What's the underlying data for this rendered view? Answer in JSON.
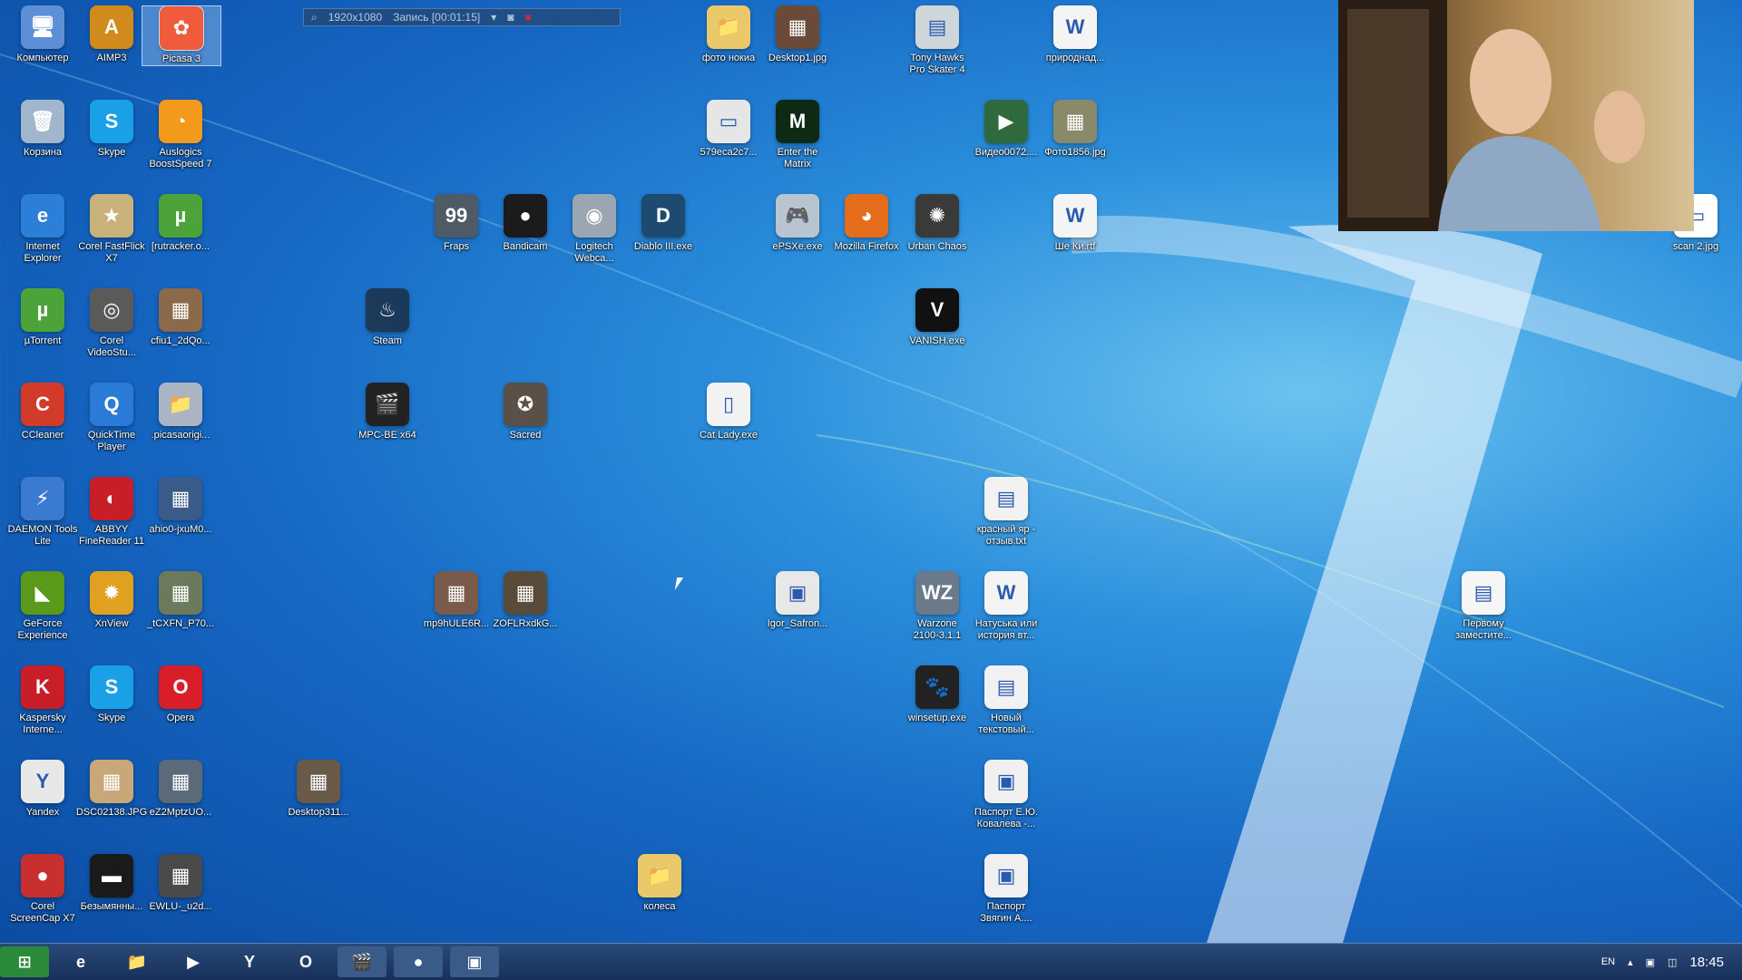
{
  "recorder": {
    "resolution": "1920x1080",
    "status": "Запись [00:01:15]"
  },
  "icons": [
    {
      "label": "Компьютер",
      "name": "computer-icon",
      "color": "#5d8fd6",
      "glyph": "🖥"
    },
    {
      "label": "AIMP3",
      "name": "aimp-icon",
      "color": "#d18a1c",
      "glyph": "A"
    },
    {
      "label": "Picasa 3",
      "name": "picasa-icon",
      "color": "#ef5b3b",
      "glyph": "✿",
      "selected": true
    },
    {
      "label": "Корзина",
      "name": "recycle-bin-icon",
      "color": "#9fb6cc",
      "glyph": "🗑"
    },
    {
      "label": "Skype",
      "name": "skype-icon",
      "color": "#1aa0e6",
      "glyph": "S"
    },
    {
      "label": "Auslogics\nBoostSpeed 7",
      "name": "auslogics-icon",
      "color": "#f39a1d",
      "glyph": "◔"
    },
    {
      "label": "Internet\nExplorer",
      "name": "internet-explorer-icon",
      "color": "#2b7fd8",
      "glyph": "e"
    },
    {
      "label": "Corel FastFlick\nX7",
      "name": "corel-fastflick-icon",
      "color": "#c9b27a",
      "glyph": "★"
    },
    {
      "label": "[rutracker.o...",
      "name": "utorrent-link-icon",
      "color": "#4ba33a",
      "glyph": "µ"
    },
    {
      "label": "Fraps",
      "name": "fraps-icon",
      "color": "#4e5a66",
      "glyph": "99"
    },
    {
      "label": "Bandicam",
      "name": "bandicam-icon",
      "color": "#1b1b1b",
      "glyph": "●"
    },
    {
      "label": "Logitech\nWebca...",
      "name": "logitech-webcam-icon",
      "color": "#9aa7b3",
      "glyph": "◉"
    },
    {
      "label": "Diablo III.exe",
      "name": "diablo-icon",
      "color": "#1f4a70",
      "glyph": "D"
    },
    {
      "label": "фото нокиа",
      "name": "folder-icon",
      "color": "#e9c96a",
      "glyph": "📁"
    },
    {
      "label": "Desktop1.jpg",
      "name": "image-file-icon",
      "color": "#6b4a3a",
      "glyph": "▦"
    },
    {
      "label": "579eca2c7...",
      "name": "image-file-icon",
      "color": "#e6e6e6",
      "glyph": "▭"
    },
    {
      "label": "Enter the\nMatrix",
      "name": "enter-the-matrix-icon",
      "color": "#0e2a14",
      "glyph": "M"
    },
    {
      "label": "ePSXe.exe",
      "name": "epsxe-icon",
      "color": "#b8c4d0",
      "glyph": "🎮"
    },
    {
      "label": "Mozilla Firefox",
      "name": "firefox-icon",
      "color": "#e46c1b",
      "glyph": "◕"
    },
    {
      "label": "Tony Hawks\nPro Skater 4",
      "name": "tony-hawk-icon",
      "color": "#cfd6da",
      "glyph": "▤"
    },
    {
      "label": "Urban Chaos",
      "name": "urban-chaos-icon",
      "color": "#3a3a3a",
      "glyph": "✺"
    },
    {
      "label": "VANISH.exe",
      "name": "vanish-icon",
      "color": "#111",
      "glyph": "V"
    },
    {
      "label": "природнад...",
      "name": "word-doc-icon",
      "color": "#f4f4f4",
      "glyph": "W"
    },
    {
      "label": "Видео0072....",
      "name": "video-file-icon",
      "color": "#2f6a3e",
      "glyph": "▶"
    },
    {
      "label": "Фото1856.jpg",
      "name": "image-file-icon",
      "color": "#8a8a6a",
      "glyph": "▦"
    },
    {
      "label": "Ше Ки.rtf",
      "name": "rtf-doc-icon",
      "color": "#f4f4f4",
      "glyph": "W"
    },
    {
      "label": "scan 2.jpg",
      "name": "image-file-icon",
      "color": "#ffffff",
      "glyph": "▭"
    },
    {
      "label": "µTorrent",
      "name": "utorrent-icon",
      "color": "#4ba33a",
      "glyph": "µ"
    },
    {
      "label": "Corel\nVideoStu...",
      "name": "corel-videostudio-icon",
      "color": "#5a5a5a",
      "glyph": "◎"
    },
    {
      "label": "cfiu1_2dQo...",
      "name": "image-file-icon",
      "color": "#8a6a4a",
      "glyph": "▦"
    },
    {
      "label": "Steam",
      "name": "steam-icon",
      "color": "#1b3a5a",
      "glyph": "♨"
    },
    {
      "label": "CCleaner",
      "name": "ccleaner-icon",
      "color": "#d23a2a",
      "glyph": "C"
    },
    {
      "label": "QuickTime\nPlayer",
      "name": "quicktime-icon",
      "color": "#2a7ad8",
      "glyph": "Q"
    },
    {
      "label": ".picasaorigi...",
      "name": "folder-icon",
      "color": "#aab4c2",
      "glyph": "📁"
    },
    {
      "label": "MPC-BE x64",
      "name": "mpc-be-icon",
      "color": "#222",
      "glyph": "🎬"
    },
    {
      "label": "Sacred",
      "name": "sacred-icon",
      "color": "#5a5048",
      "glyph": "✪"
    },
    {
      "label": "Cat Lady.exe",
      "name": "exe-file-icon",
      "color": "#f2f2f2",
      "glyph": "▯"
    },
    {
      "label": "DAEMON Tools\nLite",
      "name": "daemon-tools-icon",
      "color": "#3a7ad0",
      "glyph": "⚡"
    },
    {
      "label": "ABBYY\nFineReader 11",
      "name": "abbyy-icon",
      "color": "#c81e28",
      "glyph": "◐"
    },
    {
      "label": "ahio0-jxuM0...",
      "name": "image-file-icon",
      "color": "#3a5a8a",
      "glyph": "▦"
    },
    {
      "label": "красный яр -\nотзыв.txt",
      "name": "text-file-icon",
      "color": "#f2f2f2",
      "glyph": "▤"
    },
    {
      "label": "GeForce\nExperience",
      "name": "geforce-icon",
      "color": "#5a9a1a",
      "glyph": "◣"
    },
    {
      "label": "XnView",
      "name": "xnview-icon",
      "color": "#e0a020",
      "glyph": "✹"
    },
    {
      "label": "_tCXFN_P70...",
      "name": "image-file-icon",
      "color": "#6a7a5a",
      "glyph": "▦"
    },
    {
      "label": "mp9hULE6R...",
      "name": "image-file-icon",
      "color": "#7a5a4a",
      "glyph": "▦"
    },
    {
      "label": "ZOFLRxdkG...",
      "name": "image-file-icon",
      "color": "#5a4a3a",
      "glyph": "▦"
    },
    {
      "label": "Igor_Safron...",
      "name": "pdf-file-icon",
      "color": "#e8e8e8",
      "glyph": "▣"
    },
    {
      "label": "Warzone\n2100-3.1.1",
      "name": "warzone-icon",
      "color": "#6a7a8a",
      "glyph": "WZ"
    },
    {
      "label": "Натуська или\nистория вт...",
      "name": "word-doc-icon",
      "color": "#f4f4f4",
      "glyph": "W"
    },
    {
      "label": "Первому\nзаместите...",
      "name": "document-icon",
      "color": "#f6f6f6",
      "glyph": "▤"
    },
    {
      "label": "Kaspersky\nInterne...",
      "name": "kaspersky-icon",
      "color": "#c81e28",
      "glyph": "K"
    },
    {
      "label": "Skype",
      "name": "skype-icon",
      "color": "#1aa0e6",
      "glyph": "S"
    },
    {
      "label": "Opera",
      "name": "opera-icon",
      "color": "#d81e28",
      "glyph": "O"
    },
    {
      "label": "winsetup.exe",
      "name": "winsetup-icon",
      "color": "#222",
      "glyph": "🐾"
    },
    {
      "label": "Новый\nтекстовый...",
      "name": "text-file-icon",
      "color": "#f2f2f2",
      "glyph": "▤"
    },
    {
      "label": "Yandex",
      "name": "yandex-browser-icon",
      "color": "#e8e8e8",
      "glyph": "Y"
    },
    {
      "label": "DSC02138.JPG",
      "name": "image-file-icon",
      "color": "#c8a878",
      "glyph": "▦"
    },
    {
      "label": "eZ2MptzUO...",
      "name": "image-file-icon",
      "color": "#5a6a7a",
      "glyph": "▦"
    },
    {
      "label": "Desktop311...",
      "name": "image-file-icon",
      "color": "#6a5a4a",
      "glyph": "▦"
    },
    {
      "label": "Паспорт Е.Ю.\nКовалева -...",
      "name": "pdf-file-icon",
      "color": "#f0f0f0",
      "glyph": "▣"
    },
    {
      "label": "Corel\nScreenCap X7",
      "name": "corel-screencap-icon",
      "color": "#c83030",
      "glyph": "●"
    },
    {
      "label": "Безымянны...",
      "name": "image-file-icon",
      "color": "#1a1a1a",
      "glyph": "▬"
    },
    {
      "label": "EWLU-_u2d...",
      "name": "image-file-icon",
      "color": "#4a4a4a",
      "glyph": "▦"
    },
    {
      "label": "колеса",
      "name": "folder-icon",
      "color": "#e9c96a",
      "glyph": "📁"
    },
    {
      "label": "Паспорт\nЗвягин А....",
      "name": "pdf-file-icon",
      "color": "#f0f0f0",
      "glyph": "▣"
    }
  ],
  "taskbar": {
    "items": [
      {
        "name": "start-button",
        "color": "#2a8a3a",
        "glyph": "⊞"
      },
      {
        "name": "ie-taskbar-icon",
        "color": "transparent",
        "glyph": "e"
      },
      {
        "name": "explorer-taskbar-icon",
        "color": "transparent",
        "glyph": "📁"
      },
      {
        "name": "media-player-taskbar-icon",
        "color": "transparent",
        "glyph": "▶"
      },
      {
        "name": "yandex-taskbar-icon",
        "color": "transparent",
        "glyph": "Y"
      },
      {
        "name": "opera-taskbar-icon",
        "color": "transparent",
        "glyph": "O"
      },
      {
        "name": "mpc-taskbar-icon",
        "color": "#3a5a88",
        "glyph": "🎬"
      },
      {
        "name": "bandicam-taskbar-icon",
        "color": "#3a5a88",
        "glyph": "●"
      },
      {
        "name": "window-taskbar-icon",
        "color": "#3a5a88",
        "glyph": "▣"
      }
    ],
    "language": "EN",
    "clock": "18:45"
  }
}
